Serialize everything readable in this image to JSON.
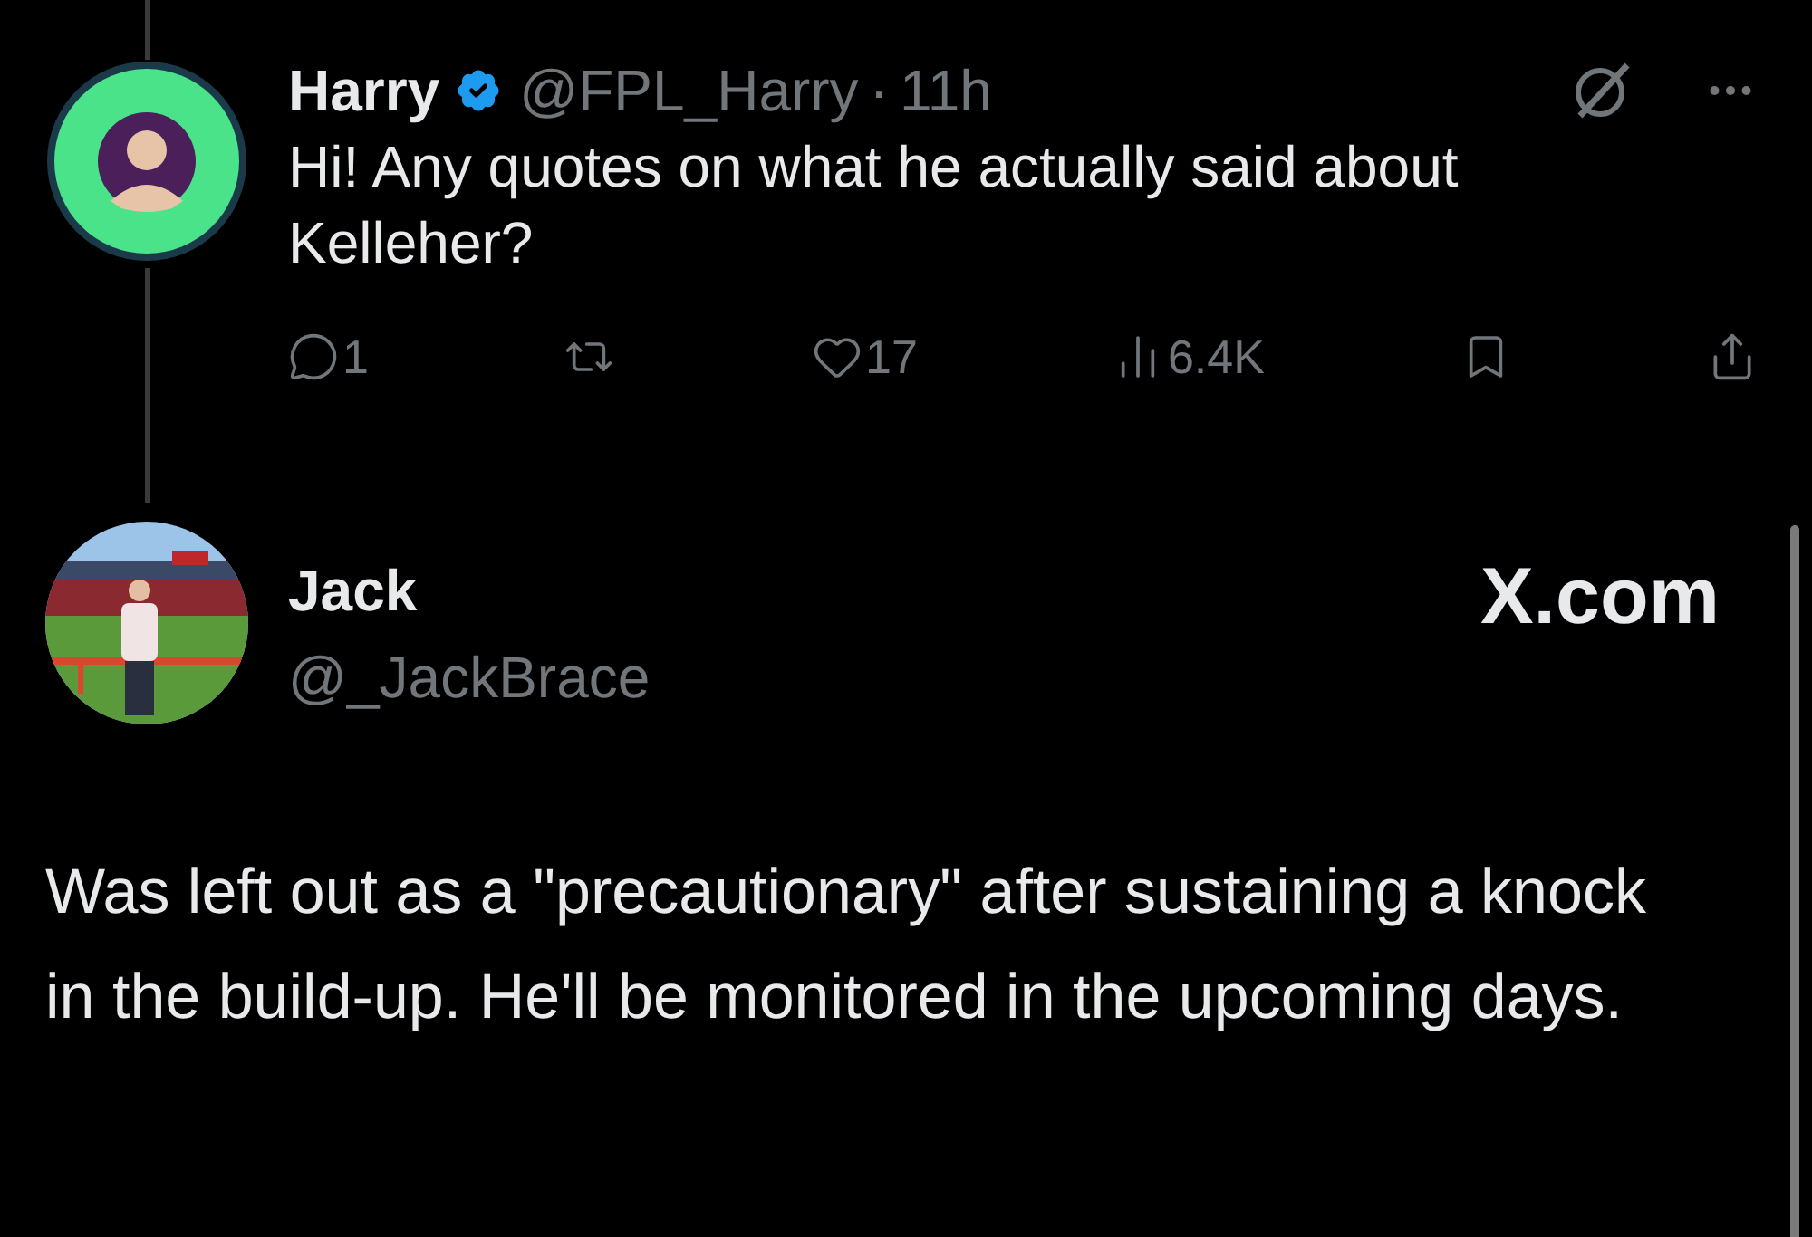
{
  "posts": [
    {
      "kind": "reply",
      "name": "Harry",
      "verified": true,
      "handle": "@FPL_Harry",
      "separator": "·",
      "time": "11h",
      "text": "Hi! Any quotes on what he actually said about Kelleher?",
      "actions": [
        {
          "kind": "reply",
          "count": "1"
        },
        {
          "kind": "repost"
        },
        {
          "kind": "like",
          "count": "17"
        },
        {
          "kind": "views",
          "count": "6.4K"
        },
        {
          "kind": "bookmark"
        },
        {
          "kind": "share"
        }
      ]
    },
    {
      "kind": "main",
      "name": "Jack",
      "handle": "@_JackBrace",
      "site": "X.com",
      "text": "Was left out as a \"precautionary\" after sustaining a knock in the build-up. He'll be monitored in the upcoming days."
    }
  ]
}
